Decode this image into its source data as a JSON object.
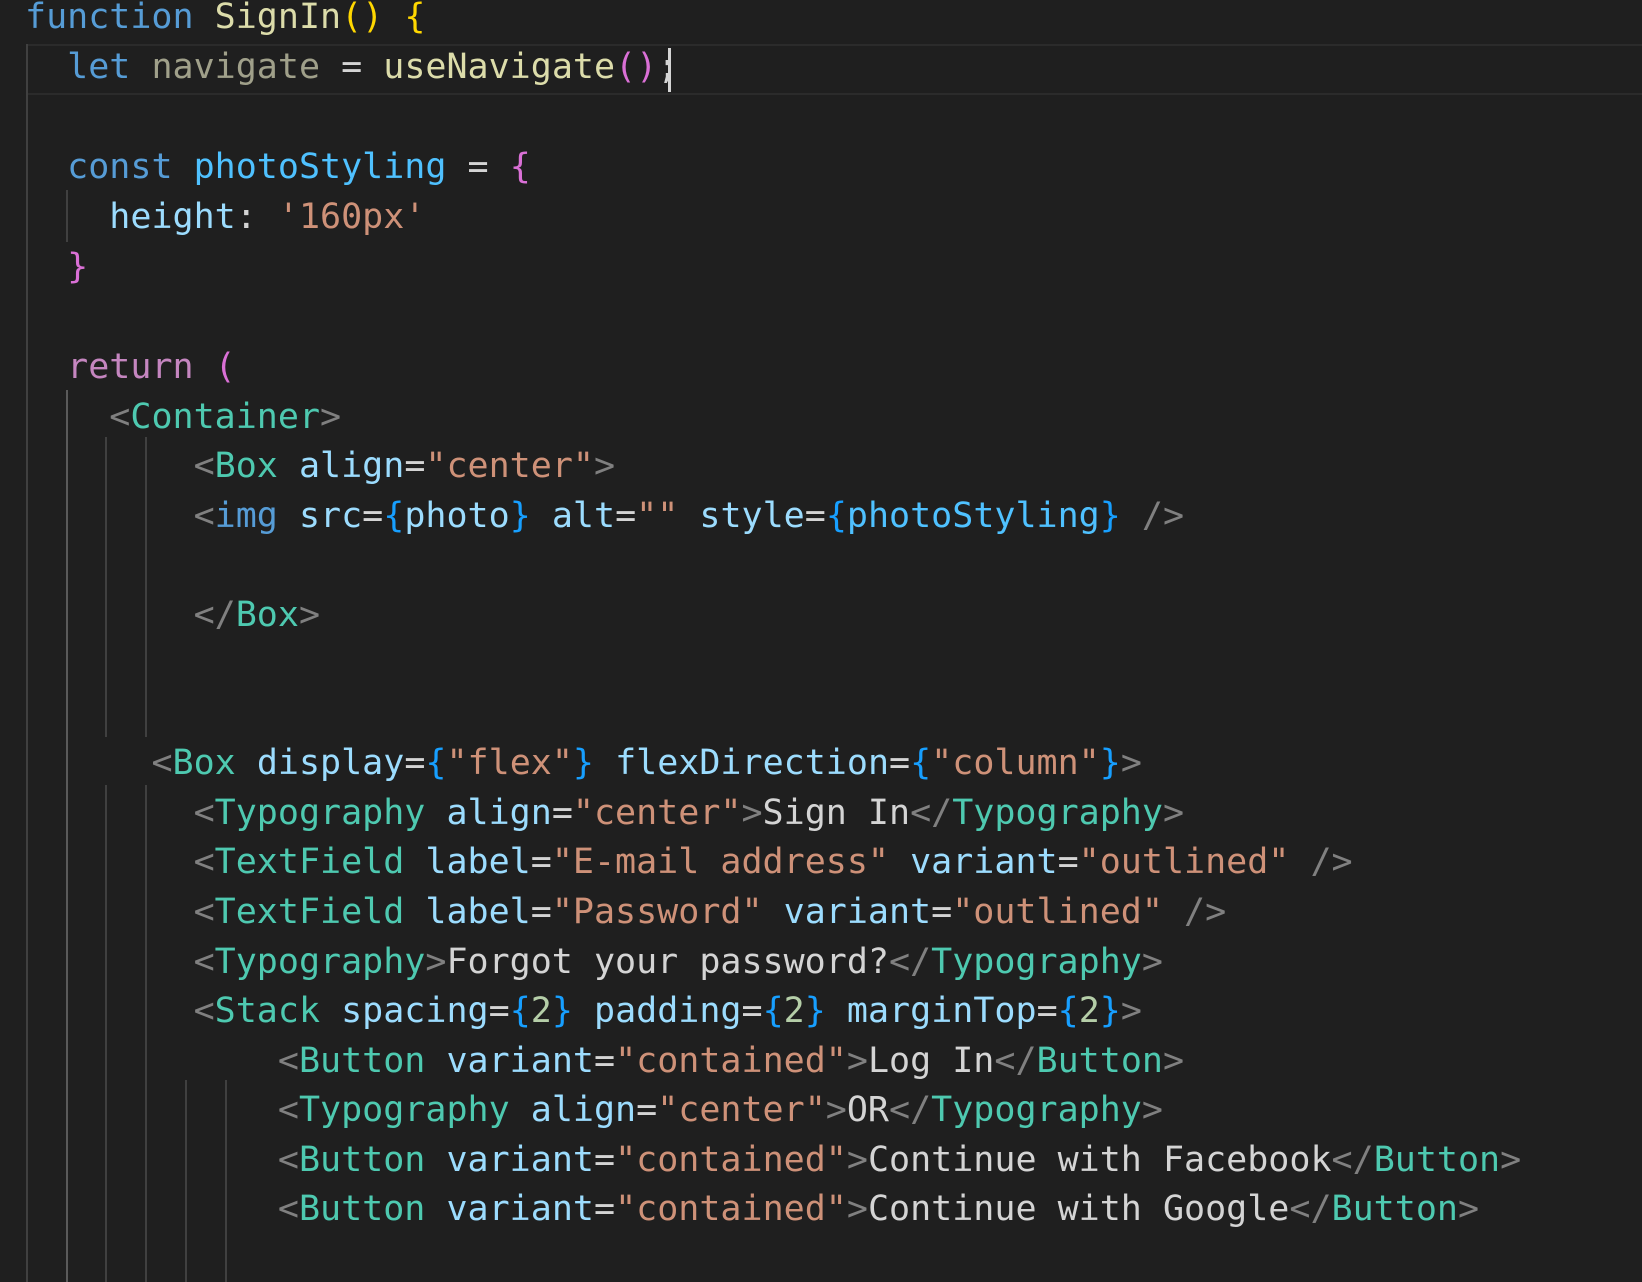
{
  "editor": {
    "lines": [
      {
        "indent": "",
        "tokens": [
          [
            "kw",
            "function"
          ],
          [
            "txt",
            " "
          ],
          [
            "fn",
            "SignIn"
          ],
          [
            "br1",
            "()"
          ],
          [
            "txt",
            " "
          ],
          [
            "br1",
            "{"
          ]
        ]
      },
      {
        "indent": "  ",
        "tokens": [
          [
            "kw",
            "let"
          ],
          [
            "txt",
            " "
          ],
          [
            "dim",
            "navigate"
          ],
          [
            "txt",
            " = "
          ],
          [
            "fn",
            "useNavigate"
          ],
          [
            "br2",
            "()"
          ],
          [
            "txt",
            ";"
          ]
        ]
      },
      {
        "indent": "",
        "tokens": []
      },
      {
        "indent": "  ",
        "tokens": [
          [
            "kw",
            "const"
          ],
          [
            "txt",
            " "
          ],
          [
            "cst",
            "photoStyling"
          ],
          [
            "txt",
            " = "
          ],
          [
            "br2",
            "{"
          ]
        ]
      },
      {
        "indent": "    ",
        "tokens": [
          [
            "var",
            "height"
          ],
          [
            "txt",
            ": "
          ],
          [
            "str",
            "'160px'"
          ]
        ]
      },
      {
        "indent": "  ",
        "tokens": [
          [
            "br2",
            "}"
          ]
        ]
      },
      {
        "indent": "",
        "tokens": []
      },
      {
        "indent": "  ",
        "tokens": [
          [
            "kw2",
            "return"
          ],
          [
            "txt",
            " "
          ],
          [
            "br2",
            "("
          ]
        ]
      },
      {
        "indent": "    ",
        "tokens": [
          [
            "punc",
            "<"
          ],
          [
            "tag",
            "Container"
          ],
          [
            "punc",
            ">"
          ]
        ]
      },
      {
        "indent": "        ",
        "tokens": [
          [
            "punc",
            "<"
          ],
          [
            "tag",
            "Box"
          ],
          [
            "txt",
            " "
          ],
          [
            "attr",
            "align"
          ],
          [
            "txt",
            "="
          ],
          [
            "str",
            "\"center\""
          ],
          [
            "punc",
            ">"
          ]
        ]
      },
      {
        "indent": "        ",
        "tokens": [
          [
            "punc",
            "<"
          ],
          [
            "tag2",
            "img"
          ],
          [
            "txt",
            " "
          ],
          [
            "attr",
            "src"
          ],
          [
            "txt",
            "="
          ],
          [
            "br3",
            "{"
          ],
          [
            "var",
            "photo"
          ],
          [
            "br3",
            "}"
          ],
          [
            "txt",
            " "
          ],
          [
            "attr",
            "alt"
          ],
          [
            "txt",
            "="
          ],
          [
            "str",
            "\"\""
          ],
          [
            "txt",
            " "
          ],
          [
            "attr",
            "style"
          ],
          [
            "txt",
            "="
          ],
          [
            "br3",
            "{"
          ],
          [
            "cst",
            "photoStyling"
          ],
          [
            "br3",
            "}"
          ],
          [
            "txt",
            " "
          ],
          [
            "punc",
            "/>"
          ]
        ]
      },
      {
        "indent": "",
        "tokens": []
      },
      {
        "indent": "        ",
        "tokens": [
          [
            "punc",
            "</"
          ],
          [
            "tag",
            "Box"
          ],
          [
            "punc",
            ">"
          ]
        ]
      },
      {
        "indent": "",
        "tokens": []
      },
      {
        "indent": "",
        "tokens": []
      },
      {
        "indent": "      ",
        "tokens": [
          [
            "punc",
            "<"
          ],
          [
            "tag",
            "Box"
          ],
          [
            "txt",
            " "
          ],
          [
            "attr",
            "display"
          ],
          [
            "txt",
            "="
          ],
          [
            "br3",
            "{"
          ],
          [
            "str",
            "\"flex\""
          ],
          [
            "br3",
            "}"
          ],
          [
            "txt",
            " "
          ],
          [
            "attr",
            "flexDirection"
          ],
          [
            "txt",
            "="
          ],
          [
            "br3",
            "{"
          ],
          [
            "str",
            "\"column\""
          ],
          [
            "br3",
            "}"
          ],
          [
            "punc",
            ">"
          ]
        ]
      },
      {
        "indent": "        ",
        "tokens": [
          [
            "punc",
            "<"
          ],
          [
            "tag",
            "Typography"
          ],
          [
            "txt",
            " "
          ],
          [
            "attr",
            "align"
          ],
          [
            "txt",
            "="
          ],
          [
            "str",
            "\"center\""
          ],
          [
            "punc",
            ">"
          ],
          [
            "txt",
            "Sign In"
          ],
          [
            "punc",
            "</"
          ],
          [
            "tag",
            "Typography"
          ],
          [
            "punc",
            ">"
          ]
        ]
      },
      {
        "indent": "        ",
        "tokens": [
          [
            "punc",
            "<"
          ],
          [
            "tag",
            "TextField"
          ],
          [
            "txt",
            " "
          ],
          [
            "attr",
            "label"
          ],
          [
            "txt",
            "="
          ],
          [
            "str",
            "\"E-mail address\""
          ],
          [
            "txt",
            " "
          ],
          [
            "attr",
            "variant"
          ],
          [
            "txt",
            "="
          ],
          [
            "str",
            "\"outlined\""
          ],
          [
            "txt",
            " "
          ],
          [
            "punc",
            "/>"
          ]
        ]
      },
      {
        "indent": "        ",
        "tokens": [
          [
            "punc",
            "<"
          ],
          [
            "tag",
            "TextField"
          ],
          [
            "txt",
            " "
          ],
          [
            "attr",
            "label"
          ],
          [
            "txt",
            "="
          ],
          [
            "str",
            "\"Password\""
          ],
          [
            "txt",
            " "
          ],
          [
            "attr",
            "variant"
          ],
          [
            "txt",
            "="
          ],
          [
            "str",
            "\"outlined\""
          ],
          [
            "txt",
            " "
          ],
          [
            "punc",
            "/>"
          ]
        ]
      },
      {
        "indent": "        ",
        "tokens": [
          [
            "punc",
            "<"
          ],
          [
            "tag",
            "Typography"
          ],
          [
            "punc",
            ">"
          ],
          [
            "txt",
            "Forgot your password?"
          ],
          [
            "punc",
            "</"
          ],
          [
            "tag",
            "Typography"
          ],
          [
            "punc",
            ">"
          ]
        ]
      },
      {
        "indent": "        ",
        "tokens": [
          [
            "punc",
            "<"
          ],
          [
            "tag",
            "Stack"
          ],
          [
            "txt",
            " "
          ],
          [
            "attr",
            "spacing"
          ],
          [
            "txt",
            "="
          ],
          [
            "br3",
            "{"
          ],
          [
            "num",
            "2"
          ],
          [
            "br3",
            "}"
          ],
          [
            "txt",
            " "
          ],
          [
            "attr",
            "padding"
          ],
          [
            "txt",
            "="
          ],
          [
            "br3",
            "{"
          ],
          [
            "num",
            "2"
          ],
          [
            "br3",
            "}"
          ],
          [
            "txt",
            " "
          ],
          [
            "attr",
            "marginTop"
          ],
          [
            "txt",
            "="
          ],
          [
            "br3",
            "{"
          ],
          [
            "num",
            "2"
          ],
          [
            "br3",
            "}"
          ],
          [
            "punc",
            ">"
          ]
        ]
      },
      {
        "indent": "            ",
        "tokens": [
          [
            "punc",
            "<"
          ],
          [
            "tag",
            "Button"
          ],
          [
            "txt",
            " "
          ],
          [
            "attr",
            "variant"
          ],
          [
            "txt",
            "="
          ],
          [
            "str",
            "\"contained\""
          ],
          [
            "punc",
            ">"
          ],
          [
            "txt",
            "Log In"
          ],
          [
            "punc",
            "</"
          ],
          [
            "tag",
            "Button"
          ],
          [
            "punc",
            ">"
          ]
        ]
      },
      {
        "indent": "            ",
        "tokens": [
          [
            "punc",
            "<"
          ],
          [
            "tag",
            "Typography"
          ],
          [
            "txt",
            " "
          ],
          [
            "attr",
            "align"
          ],
          [
            "txt",
            "="
          ],
          [
            "str",
            "\"center\""
          ],
          [
            "punc",
            ">"
          ],
          [
            "txt",
            "OR"
          ],
          [
            "punc",
            "</"
          ],
          [
            "tag",
            "Typography"
          ],
          [
            "punc",
            ">"
          ]
        ]
      },
      {
        "indent": "            ",
        "tokens": [
          [
            "punc",
            "<"
          ],
          [
            "tag",
            "Button"
          ],
          [
            "txt",
            " "
          ],
          [
            "attr",
            "variant"
          ],
          [
            "txt",
            "="
          ],
          [
            "str",
            "\"contained\""
          ],
          [
            "punc",
            ">"
          ],
          [
            "txt",
            "Continue with Facebook"
          ],
          [
            "punc",
            "</"
          ],
          [
            "tag",
            "Button"
          ],
          [
            "punc",
            ">"
          ]
        ]
      },
      {
        "indent": "            ",
        "tokens": [
          [
            "punc",
            "<"
          ],
          [
            "tag",
            "Button"
          ],
          [
            "txt",
            " "
          ],
          [
            "attr",
            "variant"
          ],
          [
            "txt",
            "="
          ],
          [
            "str",
            "\"contained\""
          ],
          [
            "punc",
            ">"
          ],
          [
            "txt",
            "Continue with Google"
          ],
          [
            "punc",
            "</"
          ],
          [
            "tag",
            "Button"
          ],
          [
            "punc",
            ">"
          ]
        ]
      }
    ]
  }
}
